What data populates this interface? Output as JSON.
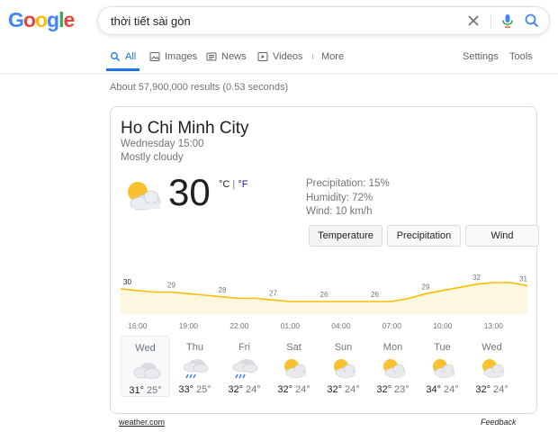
{
  "logo": {
    "letters": [
      "G",
      "o",
      "o",
      "g",
      "l",
      "e"
    ],
    "colors": [
      "#4285F4",
      "#EA4335",
      "#FBBC05",
      "#4285F4",
      "#34A853",
      "#EA4335"
    ]
  },
  "search": {
    "query": "thời tiết sài gòn"
  },
  "tabs": [
    {
      "label": "All",
      "icon": "search-icon",
      "active": true
    },
    {
      "label": "Images",
      "icon": "image-icon"
    },
    {
      "label": "News",
      "icon": "news-icon"
    },
    {
      "label": "Videos",
      "icon": "video-icon"
    },
    {
      "label": "More",
      "icon": "more-dots-icon"
    }
  ],
  "tools": {
    "settings": "Settings",
    "tools": "Tools"
  },
  "stats": "About 57,900,000 results (0.53 seconds)",
  "weather": {
    "city": "Ho Chi Minh City",
    "datetime": "Wednesday 15:00",
    "condition": "Mostly cloudy",
    "temp": "30",
    "unit_c": "°C",
    "unit_sep": "|",
    "unit_f": "°F",
    "precipitation": "Precipitation: 15%",
    "humidity": "Humidity: 72%",
    "wind": "Wind: 10 km/h",
    "chart_tabs": [
      "Temperature",
      "Precipitation",
      "Wind"
    ],
    "source": "weather.com",
    "feedback": "Feedback"
  },
  "chart_data": {
    "type": "area",
    "x": [
      "15:00",
      "16:00",
      "17:00",
      "18:00",
      "19:00",
      "20:00",
      "21:00",
      "22:00",
      "23:00",
      "00:00",
      "01:00",
      "02:00",
      "03:00",
      "04:00",
      "05:00",
      "06:00",
      "07:00",
      "08:00",
      "09:00",
      "10:00",
      "11:00",
      "12:00",
      "13:00",
      "14:00",
      "15:00"
    ],
    "y": [
      30,
      29.5,
      29,
      29,
      28.5,
      28,
      27.5,
      27,
      27,
      26.5,
      26,
      26,
      26,
      26,
      26,
      26,
      26,
      27,
      28.5,
      29.5,
      30.5,
      31.5,
      32,
      32,
      31
    ],
    "point_labels": [
      {
        "i": 0,
        "label": "30"
      },
      {
        "i": 3,
        "label": "29"
      },
      {
        "i": 6,
        "label": "28"
      },
      {
        "i": 9,
        "label": "27"
      },
      {
        "i": 12,
        "label": "26"
      },
      {
        "i": 15,
        "label": "26"
      },
      {
        "i": 18,
        "label": "29"
      },
      {
        "i": 21,
        "label": "32"
      },
      {
        "i": 24,
        "label": "31"
      }
    ],
    "tick_labels": [
      "16:00",
      "19:00",
      "22:00",
      "01:00",
      "04:00",
      "07:00",
      "10:00",
      "13:00"
    ],
    "tick_index": [
      1,
      4,
      7,
      10,
      13,
      16,
      19,
      22
    ],
    "ylim": [
      22,
      34
    ],
    "color": "#fbbc04",
    "fill": "#fef7e0"
  },
  "days": [
    {
      "name": "Wed",
      "icon": "cloudy-icon",
      "hi": "31°",
      "lo": "25°",
      "selected": true
    },
    {
      "name": "Thu",
      "icon": "rain-icon",
      "hi": "33°",
      "lo": "25°"
    },
    {
      "name": "Fri",
      "icon": "rain-icon",
      "hi": "32°",
      "lo": "24°"
    },
    {
      "name": "Sat",
      "icon": "partly-sunny-icon",
      "hi": "32°",
      "lo": "24°"
    },
    {
      "name": "Sun",
      "icon": "partly-sunny-icon",
      "hi": "32°",
      "lo": "24°"
    },
    {
      "name": "Mon",
      "icon": "partly-sunny-icon",
      "hi": "32°",
      "lo": "23°"
    },
    {
      "name": "Tue",
      "icon": "partly-sunny-icon",
      "hi": "34°",
      "lo": "24°"
    },
    {
      "name": "Wed",
      "icon": "partly-sunny-icon",
      "hi": "32°",
      "lo": "24°"
    }
  ]
}
